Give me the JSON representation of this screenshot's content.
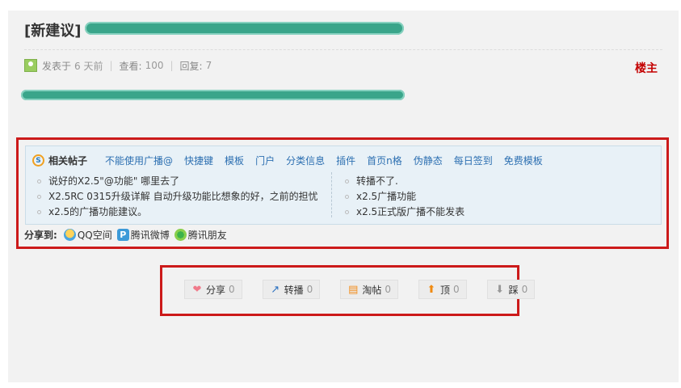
{
  "thread": {
    "title_prefix": "[新建议]",
    "meta": {
      "posted_label": "发表于",
      "posted_time": "6 天前",
      "views_label": "查看:",
      "views": "100",
      "replies_label": "回复:",
      "replies": "7"
    },
    "owner_label": "楼主"
  },
  "related": {
    "title": "相关帖子",
    "logo_letter": "S",
    "tags": [
      "不能使用广播@",
      "快捷键",
      "模板",
      "门户",
      "分类信息",
      "插件",
      "首页n格",
      "伪静态",
      "每日签到",
      "免费模板"
    ],
    "left_items": [
      "说好的X2.5\"@功能\" 哪里去了",
      "X2.5RC 0315升级详解 自动升级功能比想象的好，之前的担忧",
      "x2.5的广播功能建议。"
    ],
    "right_items": [
      "转播不了.",
      "x2.5广播功能",
      "x2.5正式版广播不能发表"
    ]
  },
  "share": {
    "label": "分享到:",
    "targets": [
      {
        "label": "QQ空间",
        "icon": "qzone-icon"
      },
      {
        "label": "腾讯微博",
        "icon": "tencent-weibo-icon"
      },
      {
        "label": "腾讯朋友",
        "icon": "tencent-pengyou-icon"
      }
    ]
  },
  "actions": [
    {
      "label": "分享",
      "count": "0",
      "icon": "heart-icon",
      "glyph": "❤"
    },
    {
      "label": "转播",
      "count": "0",
      "icon": "repost-icon",
      "glyph": "↗"
    },
    {
      "label": "淘帖",
      "count": "0",
      "icon": "taotie-icon",
      "glyph": "▤"
    },
    {
      "label": "顶",
      "count": "0",
      "icon": "thumb-up-arrow-icon",
      "glyph": "⬆"
    },
    {
      "label": "踩",
      "count": "0",
      "icon": "thumb-down-arrow-icon",
      "glyph": "⬇"
    }
  ],
  "colors": {
    "highlight_border": "#cc1a1a",
    "link": "#2c6fb1",
    "owner": "#c40000",
    "related_bg": "#e8f1f7"
  }
}
